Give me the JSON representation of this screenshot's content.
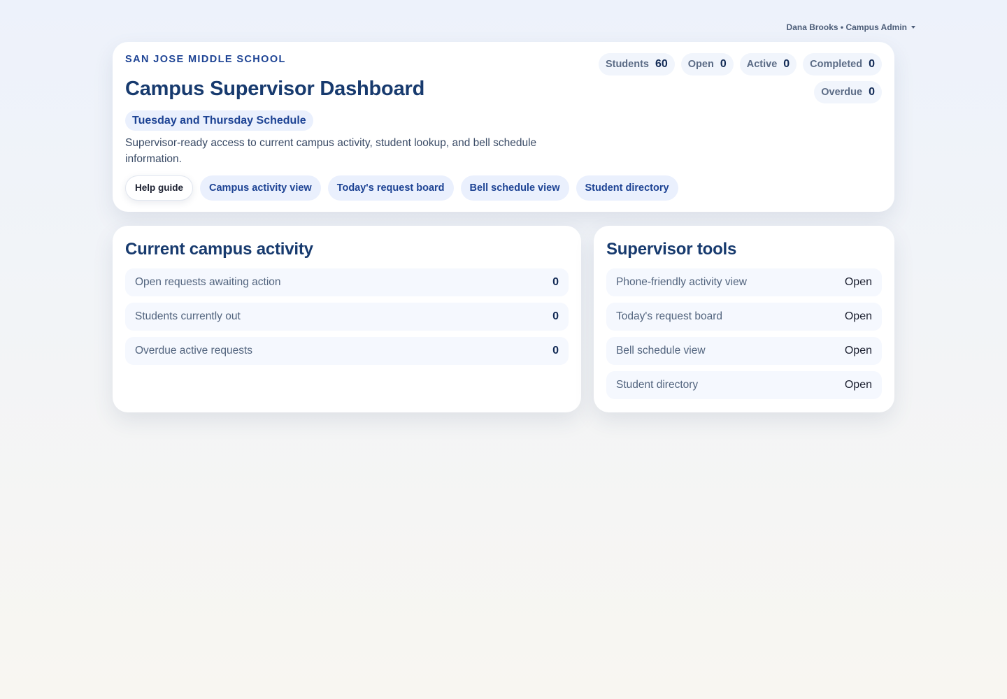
{
  "user_menu": {
    "label": "Dana Brooks • Campus Admin"
  },
  "header": {
    "eyebrow": "SAN JOSE MIDDLE SCHOOL",
    "title": "Campus Supervisor Dashboard",
    "schedule": "Tuesday and Thursday Schedule",
    "description": "Supervisor-ready access to current campus activity, student lookup, and bell schedule information.",
    "links": [
      {
        "label": "Help guide"
      },
      {
        "label": "Campus activity view"
      },
      {
        "label": "Today's request board"
      },
      {
        "label": "Bell schedule view"
      },
      {
        "label": "Student directory"
      }
    ],
    "stats": [
      {
        "label": "Students",
        "value": "60"
      },
      {
        "label": "Open",
        "value": "0"
      },
      {
        "label": "Active",
        "value": "0"
      },
      {
        "label": "Completed",
        "value": "0"
      },
      {
        "label": "Overdue",
        "value": "0"
      }
    ]
  },
  "activity": {
    "title": "Current campus activity",
    "rows": [
      {
        "label": "Open requests awaiting action",
        "value": "0"
      },
      {
        "label": "Students currently out",
        "value": "0"
      },
      {
        "label": "Overdue active requests",
        "value": "0"
      }
    ]
  },
  "tools": {
    "title": "Supervisor tools",
    "rows": [
      {
        "label": "Phone-friendly activity view",
        "action": "Open"
      },
      {
        "label": "Today's request board",
        "action": "Open"
      },
      {
        "label": "Bell schedule view",
        "action": "Open"
      },
      {
        "label": "Student directory",
        "action": "Open"
      }
    ]
  },
  "colors": {
    "primary": "#173a6e",
    "accent": "#1d4394",
    "pill_bg": "#eaf0fd",
    "row_bg": "#f5f8fe"
  }
}
